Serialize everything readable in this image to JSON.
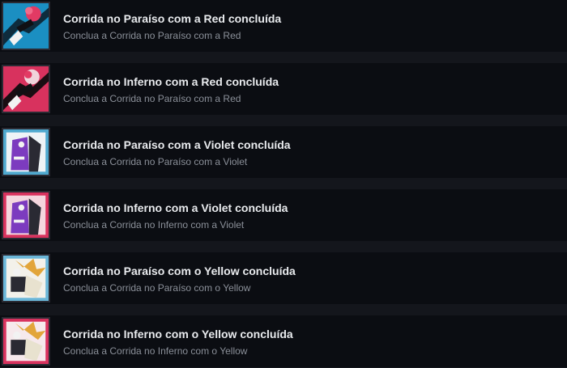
{
  "achievements": [
    {
      "title": "Corrida no Paraíso com a Red concluída",
      "description": "Conclua a Corrida no Paraíso com a Red",
      "icon": "red-paradise-badge-icon",
      "bg_color": "#1b8fc2",
      "accent_color": "#e23a64"
    },
    {
      "title": "Corrida no Inferno com a Red concluída",
      "description": "Conclua a Corrida no Paraíso com a Red",
      "icon": "red-hell-badge-icon",
      "bg_color": "#d8325e",
      "accent_color": "#f0d4dc"
    },
    {
      "title": "Corrida no Paraíso com a Violet concluída",
      "description": "Conclua a Corrida no Paraíso com a Violet",
      "icon": "violet-paradise-badge-icon",
      "bg_color": "#4fa9cf",
      "accent_color": "#7c3bbf"
    },
    {
      "title": "Corrida no Inferno com a Violet concluída",
      "description": "Conclua a Corrida no Inferno com a Violet",
      "icon": "violet-hell-badge-icon",
      "bg_color": "#d8325e",
      "accent_color": "#7c3bbf"
    },
    {
      "title": "Corrida no Paraíso com o Yellow concluída",
      "description": "Conclua a Corrida no Paraíso com o Yellow",
      "icon": "yellow-paradise-badge-icon",
      "bg_color": "#6ab6d8",
      "accent_color": "#e2a53a"
    },
    {
      "title": "Corrida no Inferno com o Yellow concluída",
      "description": "Conclua a Corrida no Inferno com o Yellow",
      "icon": "yellow-hell-badge-icon",
      "bg_color": "#d8325e",
      "accent_color": "#e2a53a"
    }
  ]
}
